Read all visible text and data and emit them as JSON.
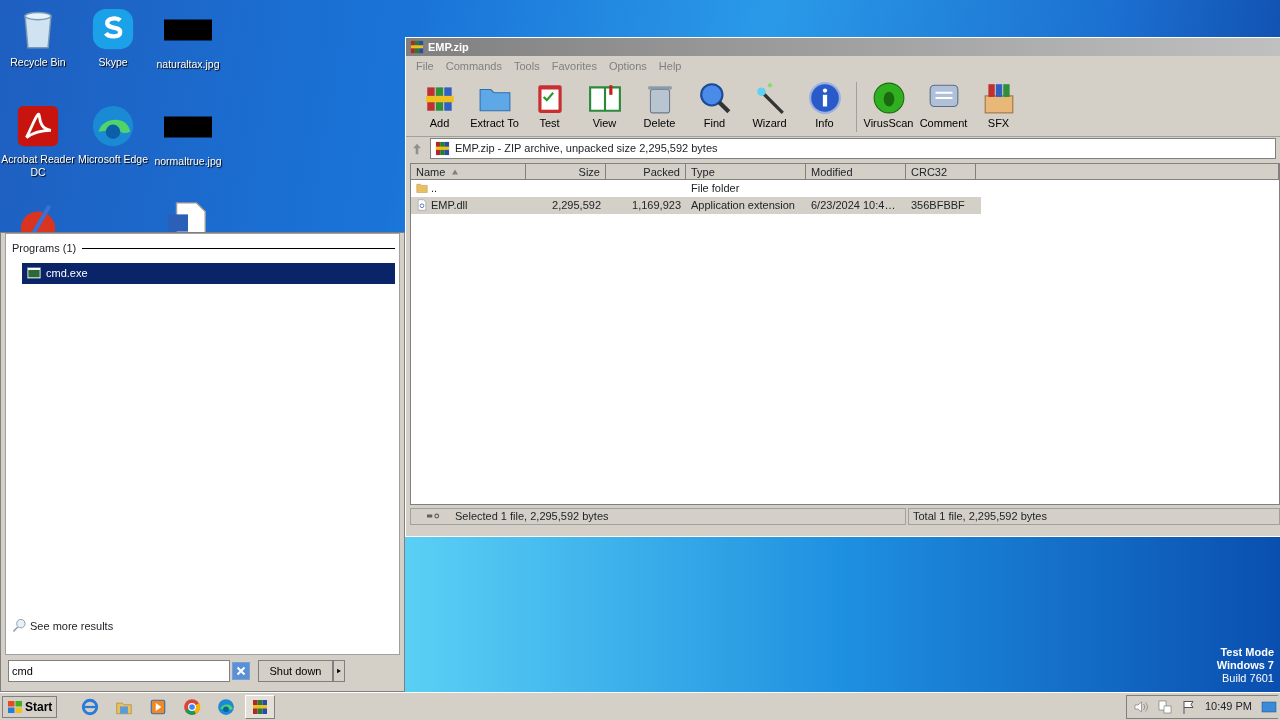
{
  "desktop_icons": [
    {
      "label": "Recycle Bin",
      "kind": "recycle"
    },
    {
      "label": "Skype",
      "kind": "skype"
    },
    {
      "label": "naturaltax.jpg",
      "kind": "image"
    },
    {
      "label": "Acrobat Reader DC",
      "kind": "acrobat"
    },
    {
      "label": "Microsoft Edge",
      "kind": "edge"
    },
    {
      "label": "normaltrue.jpg",
      "kind": "image"
    },
    {
      "kind": "ccleaner"
    },
    {
      "kind": "empty"
    },
    {
      "kind": "word"
    }
  ],
  "winrar": {
    "title": "EMP.zip",
    "menu": [
      "File",
      "Commands",
      "Tools",
      "Favorites",
      "Options",
      "Help"
    ],
    "toolbar": [
      {
        "label": "Add",
        "kind": "books"
      },
      {
        "label": "Extract To",
        "kind": "folder"
      },
      {
        "label": "Test",
        "kind": "clipboard"
      },
      {
        "label": "View",
        "kind": "book"
      },
      {
        "label": "Delete",
        "kind": "trash"
      },
      {
        "label": "Find",
        "kind": "magnifier"
      },
      {
        "label": "Wizard",
        "kind": "wand"
      },
      {
        "label": "Info",
        "kind": "info"
      },
      {
        "label": "VirusScan",
        "kind": "bug"
      },
      {
        "label": "Comment",
        "kind": "comment"
      },
      {
        "label": "SFX",
        "kind": "box"
      }
    ],
    "address": "EMP.zip - ZIP archive, unpacked size 2,295,592 bytes",
    "columns": [
      {
        "label": "Name",
        "sorted": true
      },
      {
        "label": "Size",
        "sorted": false
      },
      {
        "label": "Packed",
        "sorted": false
      },
      {
        "label": "Type",
        "sorted": false
      },
      {
        "label": "Modified",
        "sorted": false
      },
      {
        "label": "CRC32",
        "sorted": false
      }
    ],
    "rows": [
      {
        "kind": "folder",
        "name": "..",
        "size": "",
        "packed": "",
        "type": "File folder",
        "modified": "",
        "crc": "",
        "selected": false
      },
      {
        "kind": "dll",
        "name": "EMP.dll",
        "size": "2,295,592",
        "packed": "1,169,923",
        "type": "Application extension",
        "modified": "6/23/2024 10:4…",
        "crc": "356BFBBF",
        "selected": true
      }
    ],
    "status_left": "Selected 1 file, 2,295,592 bytes",
    "status_right": "Total 1 file, 2,295,592 bytes"
  },
  "start_menu": {
    "section": "Programs (1)",
    "results": [
      {
        "label": "cmd.exe",
        "selected": true
      }
    ],
    "see_more": "See more results",
    "search_value": "cmd",
    "shutdown": "Shut down"
  },
  "desktop_text": [
    "Test Mode",
    "Windows 7",
    "Build 7601"
  ],
  "taskbar": {
    "start": "Start",
    "pinned": [
      {
        "kind": "ie",
        "active": false
      },
      {
        "kind": "explorer",
        "active": false
      },
      {
        "kind": "media",
        "active": false
      },
      {
        "kind": "chrome",
        "active": false
      },
      {
        "kind": "edge",
        "active": false
      },
      {
        "kind": "winrar",
        "active": true
      }
    ],
    "clock": "10:49 PM"
  }
}
